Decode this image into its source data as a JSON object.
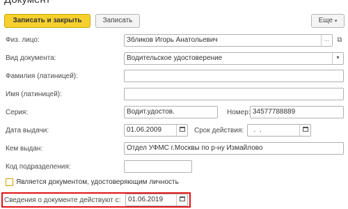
{
  "window": {
    "title": "Документ"
  },
  "toolbar": {
    "save_close_label": "Записать и закрыть",
    "save_label": "Записать",
    "more_label": "Еще",
    "more_chevron": "▾"
  },
  "fields": {
    "person": {
      "label": "Физ. лицо:",
      "value": "Збликов Игорь Анатольевич"
    },
    "doc_type": {
      "label": "Вид документа:",
      "value": "Водительское удостоверение"
    },
    "last_name_lat": {
      "label": "Фамилия (латиницей):",
      "value": ""
    },
    "first_name_lat": {
      "label": "Имя (латиницей):",
      "value": ""
    },
    "series": {
      "label": "Серия:",
      "value": "Водит.удостов."
    },
    "number": {
      "label": "Номер:",
      "value": "34577788889"
    },
    "issue_date": {
      "label": "Дата выдачи:",
      "value": "01.06.2009"
    },
    "valid_until": {
      "label": "Срок действия:",
      "value": "  .  ."
    },
    "issued_by": {
      "label": "Кем выдан:",
      "value": "Отдел УФМС г.Москвы по р-ну Измайлово"
    },
    "dept_code": {
      "label": "Код подразделения:",
      "value": ""
    },
    "is_identity": {
      "label": "Является документом, удостоверяющим личность",
      "checked": false
    },
    "valid_from": {
      "label": "Сведения о документе действуют с:",
      "value": "01.06.2019"
    }
  },
  "icons": {
    "dots": "…",
    "open": "⧉",
    "dropdown": "▾"
  },
  "colors": {
    "primary_button": "#f6d02e",
    "highlight_border": "#e21212",
    "checkbox_border": "#d4a000"
  }
}
